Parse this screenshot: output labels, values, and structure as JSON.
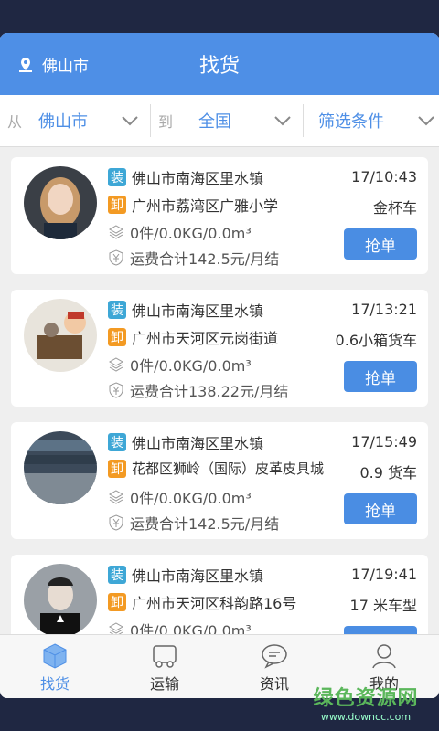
{
  "header": {
    "location": "佛山市",
    "title": "找货"
  },
  "filter": {
    "from_prefix": "从",
    "from_value": "佛山市",
    "to_prefix": "到",
    "to_value": "全国",
    "conditions": "筛选条件"
  },
  "orders": [
    {
      "load": "佛山市南海区里水镇",
      "unload": "广州市荔湾区广雅小学",
      "time": "17/10:43",
      "vehicle": "金杯车",
      "cargo": "0件/0.0KG/0.0m³",
      "fee": "运费合计142.5元/月结",
      "button": "抢单",
      "tag_load": "装",
      "tag_unload": "卸"
    },
    {
      "load": "佛山市南海区里水镇",
      "unload": "广州市天河区元岗街道",
      "time": "17/13:21",
      "vehicle": "0.6小箱货车",
      "cargo": "0件/0.0KG/0.0m³",
      "fee": "运费合计138.22元/月结",
      "button": "抢单",
      "tag_load": "装",
      "tag_unload": "卸"
    },
    {
      "load": "佛山市南海区里水镇",
      "unload": "花都区狮岭（国际）皮革皮具城",
      "time": "17/15:49",
      "vehicle": "0.9 货车",
      "cargo": "0件/0.0KG/0.0m³",
      "fee": "运费合计142.5元/月结",
      "button": "抢单",
      "tag_load": "装",
      "tag_unload": "卸"
    },
    {
      "load": "佛山市南海区里水镇",
      "unload": "广州市天河区科韵路16号",
      "time": "17/19:41",
      "vehicle": "17 米车型",
      "cargo": "0件/0.0KG/0.0m³",
      "fee": "",
      "button": "抢单",
      "tag_load": "装",
      "tag_unload": "卸"
    }
  ],
  "tabs": [
    {
      "label": "找货",
      "icon": "cube-icon",
      "active": true
    },
    {
      "label": "运输",
      "icon": "truck-icon"
    },
    {
      "label": "资讯",
      "icon": "chat-bubble-icon"
    },
    {
      "label": "我的",
      "icon": "user-icon"
    }
  ],
  "watermark": {
    "title": "绿色资源网",
    "url": "www.downcc.com"
  },
  "colors": {
    "primary": "#4e8fe6",
    "load_tag": "#3ea7d6",
    "unload_tag": "#f39a23",
    "background": "#1f2742"
  }
}
